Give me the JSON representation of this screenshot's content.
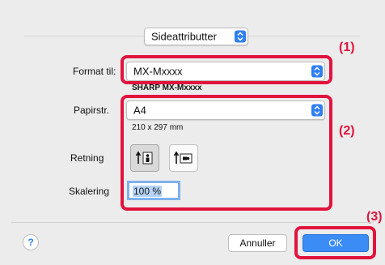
{
  "section_popup": {
    "value": "Sideattributter"
  },
  "format": {
    "label": "Format til:",
    "value": "MX-Mxxxx",
    "subtitle": "SHARP MX-Mxxxx"
  },
  "paper": {
    "label": "Papirstr.",
    "value": "A4",
    "size": "210 x 297 mm"
  },
  "orientation": {
    "label": "Retning",
    "selected": "portrait",
    "options": [
      "portrait-icon",
      "landscape-icon"
    ]
  },
  "scale": {
    "label": "Skalering",
    "value": "100 %"
  },
  "callouts": {
    "one": "(1)",
    "two": "(2)",
    "three": "(3)"
  },
  "buttons": {
    "help": "?",
    "cancel": "Annuller",
    "ok": "OK"
  },
  "colors": {
    "highlight": "#e2133d",
    "accent": "#3b8cf5",
    "dialog_bg": "#ececec"
  }
}
